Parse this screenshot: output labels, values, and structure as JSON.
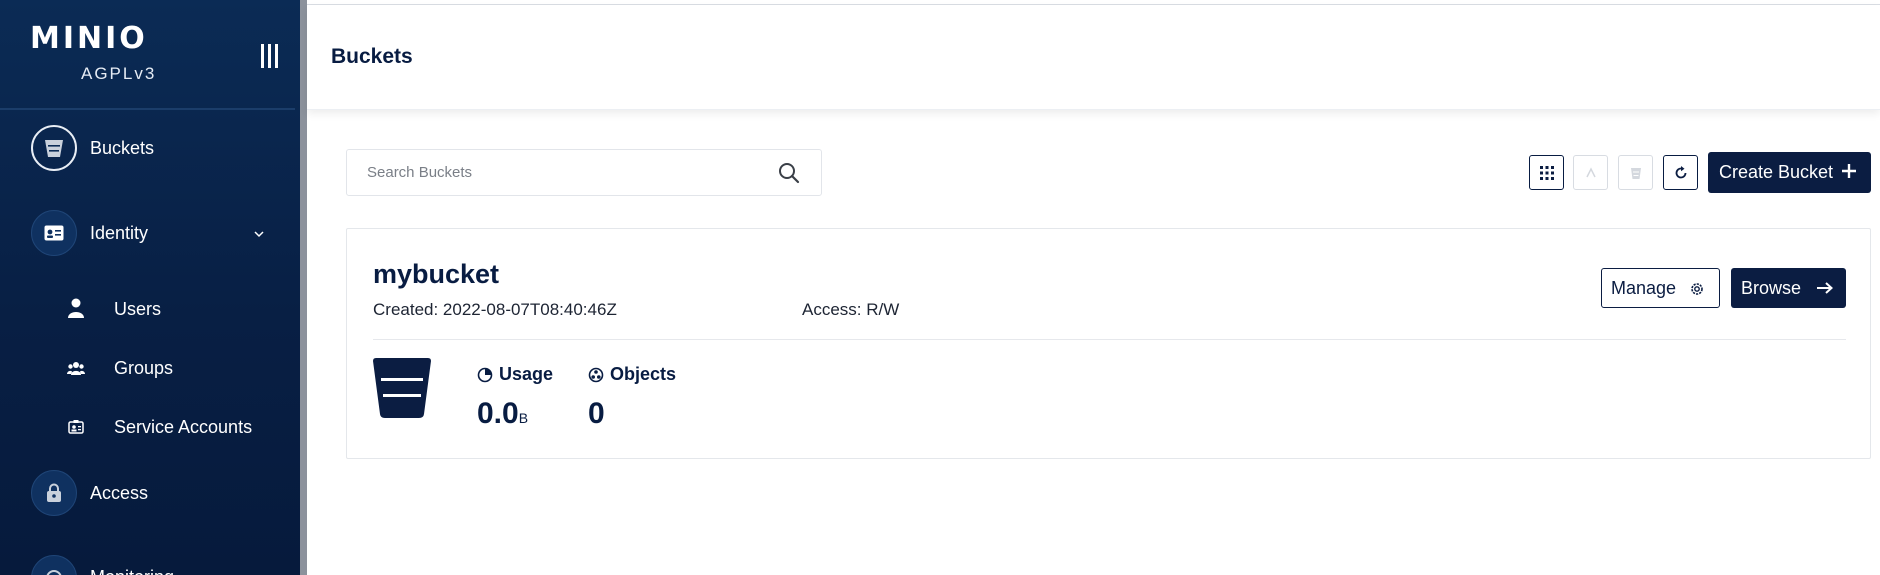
{
  "sidebar": {
    "logo": "MINIO",
    "license": "AGPLv3",
    "items": [
      {
        "label": "Buckets",
        "icon": "bucket-icon",
        "active": true
      },
      {
        "label": "Identity",
        "icon": "id-card-icon"
      },
      {
        "label": "Users",
        "icon": "user-icon"
      },
      {
        "label": "Groups",
        "icon": "groups-icon"
      },
      {
        "label": "Service Accounts",
        "icon": "service-account-icon"
      },
      {
        "label": "Access",
        "icon": "lock-icon"
      },
      {
        "label": "Monitoring",
        "icon": "monitoring-icon"
      }
    ]
  },
  "header": {
    "title": "Buckets"
  },
  "toolbar": {
    "search_placeholder": "Search Buckets",
    "create_label": "Create Bucket"
  },
  "bucket": {
    "name": "mybucket",
    "created": "Created: 2022-08-07T08:40:46Z",
    "access": "Access: R/W",
    "manage_label": "Manage",
    "browse_label": "Browse",
    "usage_label": "Usage",
    "usage_value": "0.0",
    "usage_unit": "B",
    "objects_label": "Objects",
    "objects_value": "0"
  },
  "colors": {
    "sidebar": "#0b2b55",
    "accent": "#0b1d42",
    "text": "#081c42"
  }
}
